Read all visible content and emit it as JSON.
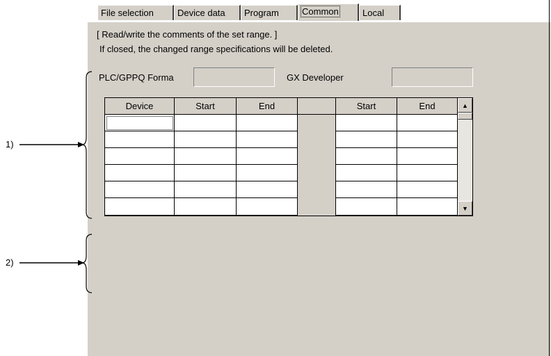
{
  "tabs": [
    {
      "label": "File selection",
      "active": false
    },
    {
      "label": "Device data",
      "active": false
    },
    {
      "label": "Program",
      "active": false
    },
    {
      "label": "Common",
      "active": true
    },
    {
      "label": "Local",
      "active": false
    }
  ],
  "description": {
    "line1": "[ Read/write the comments of the set range. ]",
    "line2": "If closed, the changed range specifications will be deleted."
  },
  "fields": {
    "plc_label": "PLC/GPPQ Forma",
    "plc_value": "",
    "gx_label": "GX Developer",
    "gx_value": ""
  },
  "table": {
    "headers": [
      "Device",
      "Start",
      "End",
      "",
      "Start",
      "End"
    ],
    "rows": [
      [
        "",
        "",
        "",
        "",
        "",
        ""
      ],
      [
        "",
        "",
        "",
        "",
        "",
        ""
      ],
      [
        "",
        "",
        "",
        "",
        "",
        ""
      ],
      [
        "",
        "",
        "",
        "",
        "",
        ""
      ],
      [
        "",
        "",
        "",
        "",
        "",
        ""
      ],
      [
        "",
        "",
        "",
        "",
        "",
        ""
      ]
    ]
  },
  "scrollbar": {
    "up_icon": "arrow-up-icon",
    "down_icon": "arrow-down-icon"
  },
  "callouts": [
    {
      "label": "1)"
    },
    {
      "label": "2)"
    }
  ]
}
